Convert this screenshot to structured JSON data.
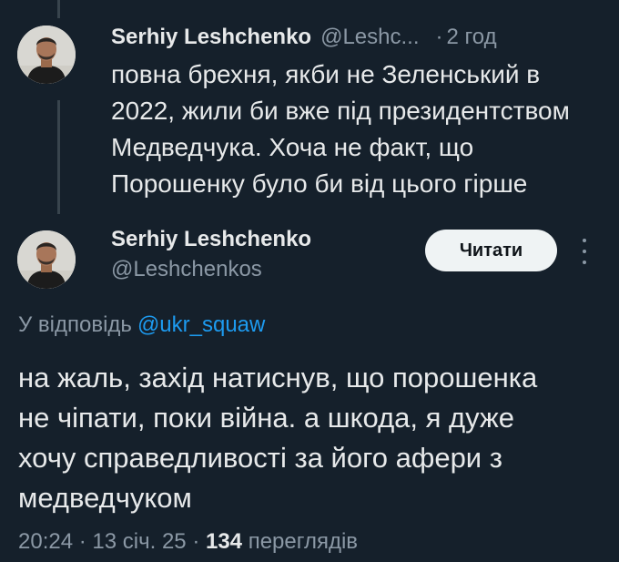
{
  "parent_tweet": {
    "author_name": "Serhiy Leshchenko",
    "author_handle": "@Leshc...",
    "separator": "·",
    "time": "2 год",
    "text": "повна брехня, якби не Зеленський в\n2022, жили би вже під президентством\nМедведчука. Хоча не факт, що\nПорошенку було би від цього гірше"
  },
  "main_tweet": {
    "author_name": "Serhiy Leshchenko",
    "author_handle": "@Leshchenkos",
    "follow_label": "Читати",
    "more_icon": "more-vertical-icon",
    "reply_to_label": "У відповідь",
    "reply_to_handle": "@ukr_squaw",
    "text": "на жаль, захід натиснув, що порошенка\nне чіпати, поки війна. а шкода, я дуже\nхочу справедливості за його афери з\nмедведчуком",
    "time": "20:24",
    "date": "13 січ. 25",
    "separator": "·",
    "views_count": "134",
    "views_label": "переглядів"
  },
  "colors": {
    "background": "#15202b",
    "primary_text": "#e7e9ea",
    "secondary_text": "#8b98a5",
    "link": "#1d9bf0",
    "button_bg": "#eff3f4",
    "thread_line": "#38444d"
  }
}
